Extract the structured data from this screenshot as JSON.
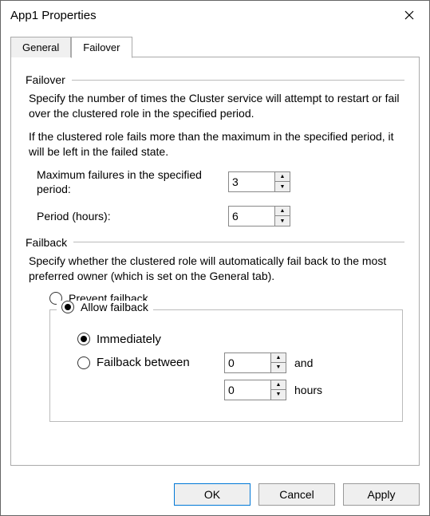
{
  "window": {
    "title": "App1 Properties"
  },
  "tabs": {
    "general": "General",
    "failover": "Failover",
    "active": "failover"
  },
  "failover_section": {
    "heading": "Failover",
    "desc1": "Specify the number of times the Cluster service will attempt to restart or fail over the clustered role in the specified period.",
    "desc2": "If the clustered role fails more than the maximum in the specified period, it will be left in the failed state.",
    "max_failures_label": "Maximum failures in the specified period:",
    "max_failures_value": "3",
    "period_label": "Period (hours):",
    "period_value": "6"
  },
  "failback_section": {
    "heading": "Failback",
    "desc": "Specify whether the clustered role will automatically fail back to the most preferred owner (which is set on the General tab).",
    "prevent_label": "Prevent failback",
    "allow_label": "Allow failback",
    "selected": "allow",
    "immediately_label": "Immediately",
    "between_label": "Failback between",
    "inner_selected": "immediately",
    "between_start": "0",
    "and_label": "and",
    "between_end": "0",
    "hours_label": "hours"
  },
  "buttons": {
    "ok": "OK",
    "cancel": "Cancel",
    "apply": "Apply"
  }
}
